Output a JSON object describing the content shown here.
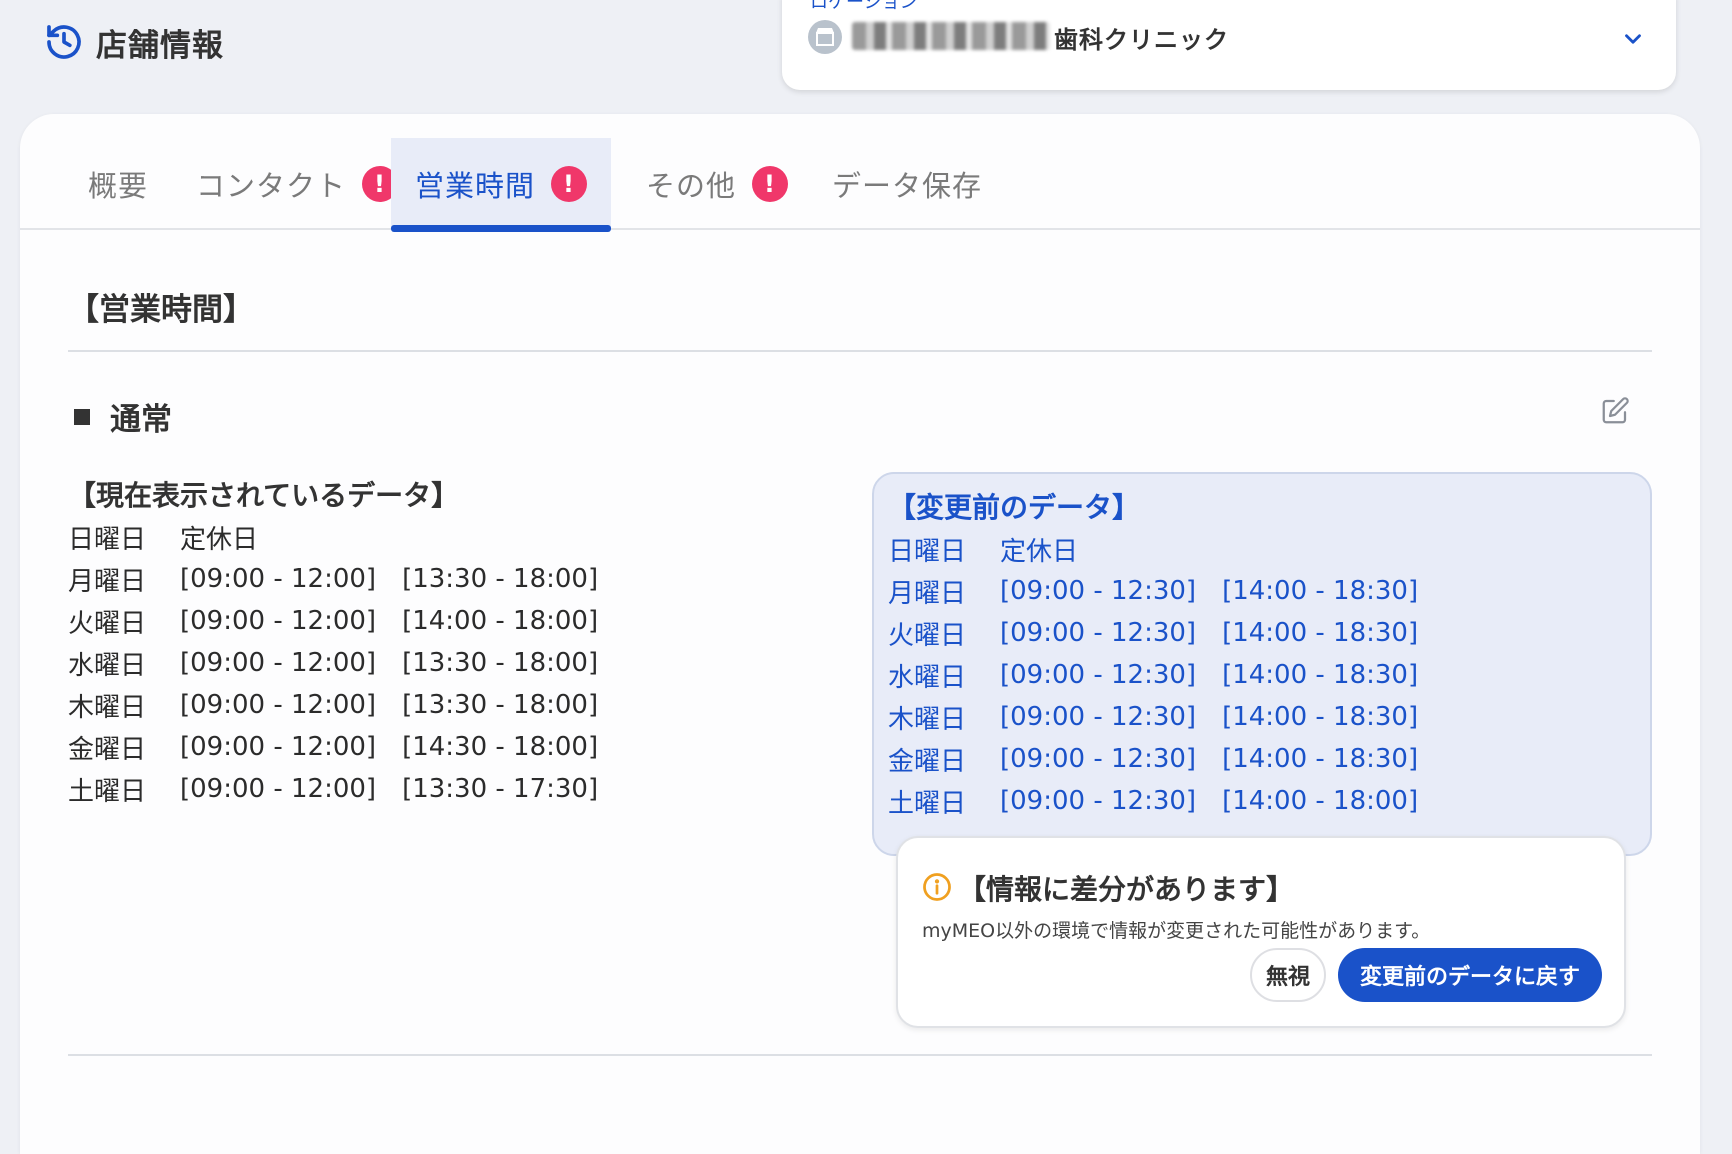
{
  "header": {
    "title": "店舗情報",
    "store_select": {
      "peek_label": "ロケーション",
      "avatar_text": "🏪",
      "store_name": "歯科クリニック"
    }
  },
  "tabs": [
    {
      "label": "概要",
      "warning": false
    },
    {
      "label": "コンタクト",
      "warning": true,
      "badge": "!"
    },
    {
      "label": "営業時間",
      "warning": true,
      "badge": "!",
      "active": true
    },
    {
      "label": "その他",
      "warning": true,
      "badge": "!"
    },
    {
      "label": "データ保存",
      "warning": false
    }
  ],
  "section": {
    "title": "【営業時間】",
    "sub_title": "通常"
  },
  "current": {
    "title": "【現在表示されているデータ】",
    "rows": [
      {
        "day": "日曜日",
        "slots": [
          "定休日"
        ]
      },
      {
        "day": "月曜日",
        "slots": [
          "[09:00 - 12:00]",
          "[13:30 - 18:00]"
        ]
      },
      {
        "day": "火曜日",
        "slots": [
          "[09:00 - 12:00]",
          "[14:00 - 18:00]"
        ]
      },
      {
        "day": "水曜日",
        "slots": [
          "[09:00 - 12:00]",
          "[13:30 - 18:00]"
        ]
      },
      {
        "day": "木曜日",
        "slots": [
          "[09:00 - 12:00]",
          "[13:30 - 18:00]"
        ]
      },
      {
        "day": "金曜日",
        "slots": [
          "[09:00 - 12:00]",
          "[14:30 - 18:00]"
        ]
      },
      {
        "day": "土曜日",
        "slots": [
          "[09:00 - 12:00]",
          "[13:30 - 17:30]"
        ]
      }
    ]
  },
  "previous": {
    "title": "【変更前のデータ】",
    "rows": [
      {
        "day": "日曜日",
        "slots": [
          "定休日"
        ]
      },
      {
        "day": "月曜日",
        "slots": [
          "[09:00 - 12:30]",
          "[14:00 - 18:30]"
        ]
      },
      {
        "day": "火曜日",
        "slots": [
          "[09:00 - 12:30]",
          "[14:00 - 18:30]"
        ]
      },
      {
        "day": "水曜日",
        "slots": [
          "[09:00 - 12:30]",
          "[14:00 - 18:30]"
        ]
      },
      {
        "day": "木曜日",
        "slots": [
          "[09:00 - 12:30]",
          "[14:00 - 18:30]"
        ]
      },
      {
        "day": "金曜日",
        "slots": [
          "[09:00 - 12:30]",
          "[14:00 - 18:30]"
        ]
      },
      {
        "day": "土曜日",
        "slots": [
          "[09:00 - 12:30]",
          "[14:00 - 18:00]"
        ]
      }
    ]
  },
  "notice": {
    "title": "【情報に差分があります】",
    "text": "myMEO以外の環境で情報が変更された可能性があります。",
    "ignore_label": "無視",
    "revert_label": "変更前のデータに戻す"
  },
  "colors": {
    "accent": "#1a52c9",
    "warning_badge": "#f0376a",
    "notice_icon": "#f0a020",
    "active_tab_bg": "#e8ecf8"
  },
  "icons": {
    "header": "history-icon",
    "select": "chevron-down-icon",
    "edit": "edit-icon",
    "notice": "info-icon"
  }
}
